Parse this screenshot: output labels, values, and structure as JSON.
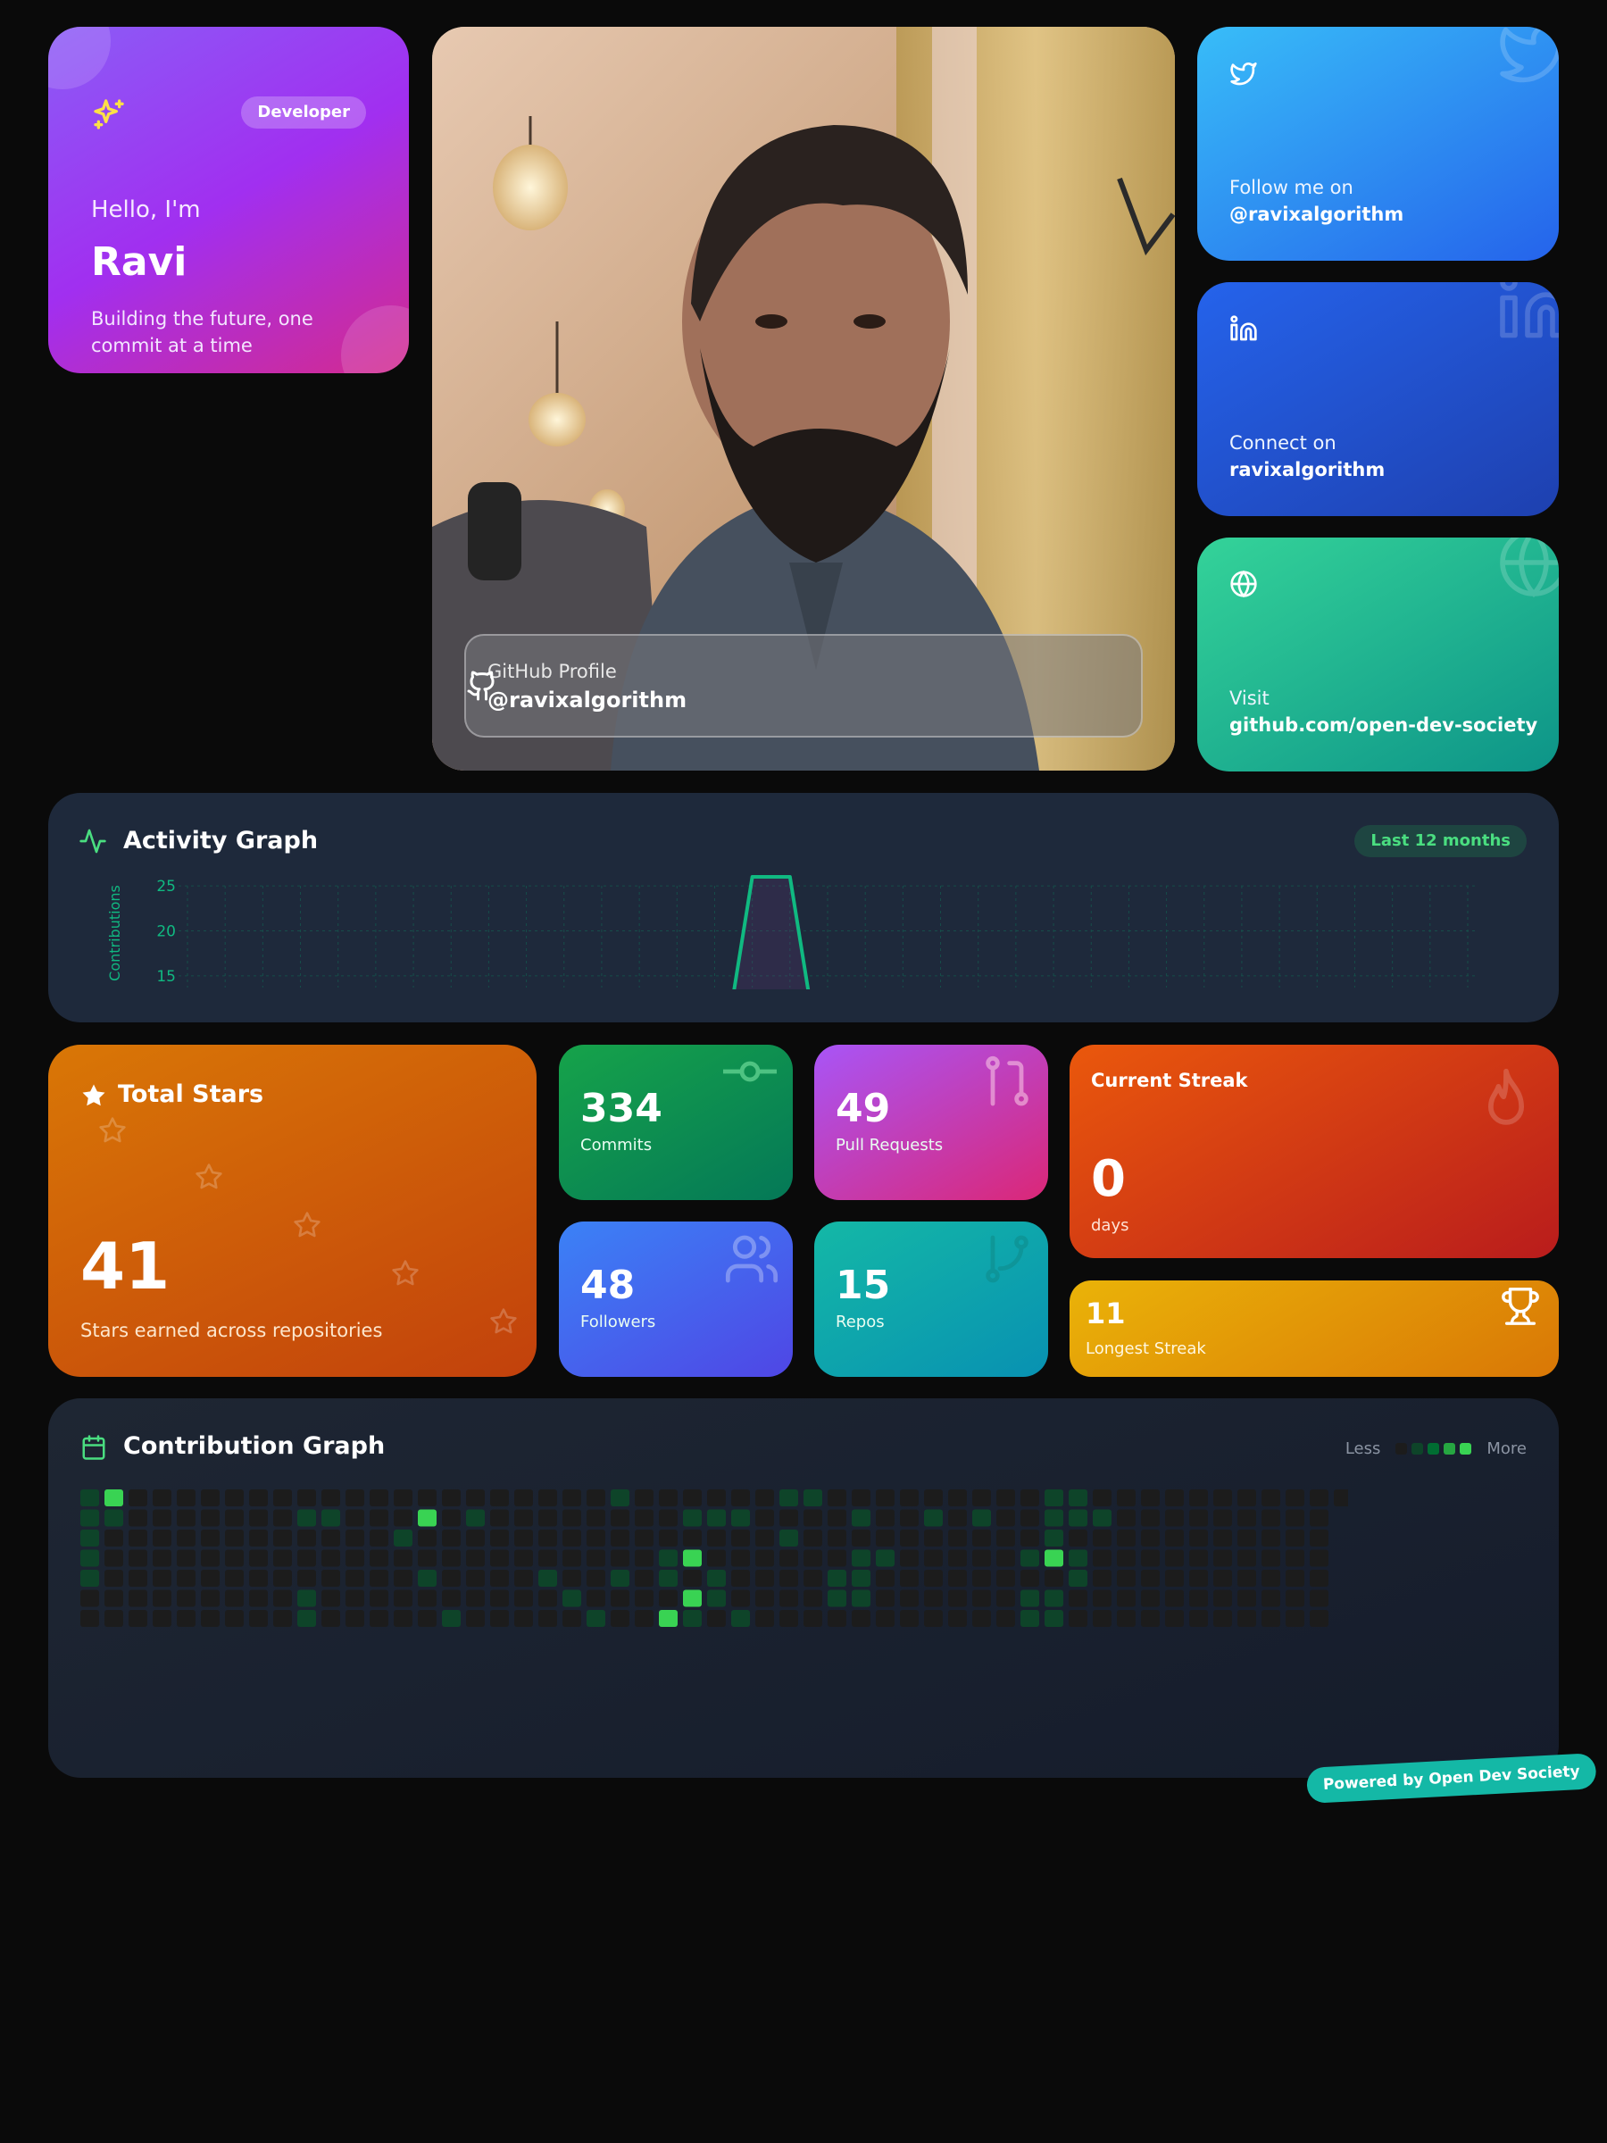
{
  "intro": {
    "badge": "Developer",
    "greeting": "Hello, I'm",
    "name": "Ravi",
    "tagline": "Building the future, one commit at a time"
  },
  "photo": {
    "overlay_label": "GitHub Profile",
    "overlay_handle": "@ravixalgorithm",
    "icon": "github-icon"
  },
  "socials": [
    {
      "icon": "twitter-icon",
      "label": "Follow me on",
      "value": "@ravixalgorithm",
      "color": "#2563eb"
    },
    {
      "icon": "linkedin-icon",
      "label": "Connect on",
      "value": "ravixalgorithm",
      "color": "#1e40af"
    },
    {
      "icon": "globe-icon",
      "label": "Visit",
      "value": "github.com/open-dev-society",
      "color": "#0d9488"
    }
  ],
  "activity": {
    "title": "Activity Graph",
    "range_pill": "Last 12 months",
    "icon": "activity-icon"
  },
  "chart_data": {
    "type": "line",
    "title": "Activity Graph",
    "ylabel": "Contributions",
    "yticks": [
      25,
      20,
      15
    ],
    "ylim": [
      13.5,
      26
    ],
    "series": [
      {
        "values": [
          0,
          0,
          0,
          0,
          0,
          0,
          0,
          0,
          0,
          0,
          0,
          0,
          0,
          0,
          0,
          0,
          0,
          0,
          0,
          0,
          0,
          0,
          0,
          0,
          0,
          0,
          0,
          0,
          0,
          0,
          0,
          0,
          0,
          0,
          0
        ]
      },
      {
        "values": [
          0,
          0,
          0,
          0,
          0,
          0,
          0,
          0,
          0,
          0,
          0,
          0,
          0,
          0,
          0,
          26,
          26,
          0,
          0,
          0,
          0,
          0,
          0,
          0,
          0,
          0,
          0,
          0,
          0,
          0,
          0,
          0,
          0,
          0,
          0
        ]
      }
    ],
    "color": "#10b981"
  },
  "stats": {
    "stars": {
      "title": "Total Stars",
      "value": "41",
      "desc": "Stars earned across repositories"
    },
    "commits": {
      "value": "334",
      "label": "Commits"
    },
    "prs": {
      "value": "49",
      "label": "Pull Requests"
    },
    "followers": {
      "value": "48",
      "label": "Followers"
    },
    "repos": {
      "value": "15",
      "label": "Repos"
    },
    "current_streak": {
      "title": "Current Streak",
      "value": "0",
      "unit": "days"
    },
    "longest_streak": {
      "value": "11",
      "label": "Longest Streak"
    }
  },
  "contrib": {
    "title": "Contribution Graph",
    "legend_less": "Less",
    "legend_more": "More",
    "level_colors": [
      "#1c1c1c",
      "#0e4429",
      "#006d32",
      "#26a641",
      "#39d353"
    ],
    "weeks": [
      [
        1,
        1,
        1,
        1,
        1,
        0,
        0
      ],
      [
        4,
        1,
        0,
        0,
        0,
        0,
        0
      ],
      [
        0,
        0,
        0,
        0,
        0,
        0,
        0
      ],
      [
        0,
        0,
        0,
        0,
        0,
        0,
        0
      ],
      [
        0,
        0,
        0,
        0,
        0,
        0,
        0
      ],
      [
        0,
        0,
        0,
        0,
        0,
        0,
        0
      ],
      [
        0,
        0,
        0,
        0,
        0,
        0,
        0
      ],
      [
        0,
        0,
        0,
        0,
        0,
        0,
        0
      ],
      [
        0,
        0,
        0,
        0,
        0,
        0,
        0
      ],
      [
        0,
        1,
        0,
        0,
        0,
        1,
        1
      ],
      [
        0,
        1,
        0,
        0,
        0,
        0,
        0
      ],
      [
        0,
        0,
        0,
        0,
        0,
        0,
        0
      ],
      [
        0,
        0,
        0,
        0,
        0,
        0,
        0
      ],
      [
        0,
        0,
        1,
        0,
        0,
        0,
        0
      ],
      [
        0,
        4,
        0,
        0,
        1,
        0,
        0
      ],
      [
        0,
        0,
        0,
        0,
        0,
        0,
        1
      ],
      [
        0,
        1,
        0,
        0,
        0,
        0,
        0
      ],
      [
        0,
        0,
        0,
        0,
        0,
        0,
        0
      ],
      [
        0,
        0,
        0,
        0,
        0,
        0,
        0
      ],
      [
        0,
        0,
        0,
        0,
        1,
        0,
        0
      ],
      [
        0,
        0,
        0,
        0,
        0,
        1,
        0
      ],
      [
        0,
        0,
        0,
        0,
        0,
        0,
        1
      ],
      [
        1,
        0,
        0,
        0,
        1,
        0,
        0
      ],
      [
        0,
        0,
        0,
        0,
        0,
        0,
        0
      ],
      [
        0,
        0,
        0,
        1,
        1,
        0,
        4
      ],
      [
        0,
        1,
        0,
        4,
        0,
        4,
        1
      ],
      [
        0,
        1,
        0,
        0,
        1,
        1,
        0
      ],
      [
        0,
        1,
        0,
        0,
        0,
        0,
        1
      ],
      [
        0,
        0,
        0,
        0,
        0,
        0,
        0
      ],
      [
        1,
        0,
        1,
        0,
        0,
        0,
        0
      ],
      [
        1,
        0,
        0,
        0,
        0,
        0,
        0
      ],
      [
        0,
        0,
        0,
        0,
        1,
        1,
        0
      ],
      [
        0,
        1,
        0,
        1,
        1,
        1,
        0
      ],
      [
        0,
        0,
        0,
        1,
        0,
        0,
        0
      ],
      [
        0,
        0,
        0,
        0,
        0,
        0,
        0
      ],
      [
        0,
        1,
        0,
        0,
        0,
        0,
        0
      ],
      [
        0,
        0,
        0,
        0,
        0,
        0,
        0
      ],
      [
        0,
        1,
        0,
        0,
        0,
        0,
        0
      ],
      [
        0,
        0,
        0,
        0,
        0,
        0,
        0
      ],
      [
        0,
        0,
        0,
        1,
        0,
        1,
        1
      ],
      [
        1,
        1,
        1,
        4,
        0,
        1,
        1
      ],
      [
        1,
        1,
        0,
        1,
        1,
        0,
        0
      ],
      [
        0,
        1,
        0,
        0,
        0,
        0,
        0
      ],
      [
        0,
        0,
        0,
        0,
        0,
        0,
        0
      ],
      [
        0,
        0,
        0,
        0,
        0,
        0,
        0
      ],
      [
        0,
        0,
        0,
        0,
        0,
        0,
        0
      ],
      [
        0,
        0,
        0,
        0,
        0,
        0,
        0
      ],
      [
        0,
        0,
        0,
        0,
        0,
        0,
        0
      ],
      [
        0,
        0,
        0,
        0,
        0,
        0,
        0
      ],
      [
        0,
        0,
        0,
        0,
        0,
        0,
        0
      ],
      [
        0,
        0,
        0,
        0,
        0,
        0,
        0
      ],
      [
        0,
        0,
        0,
        0,
        0,
        0,
        0
      ],
      [
        0
      ]
    ]
  },
  "footer": {
    "powered": "Powered by Open Dev Society"
  }
}
